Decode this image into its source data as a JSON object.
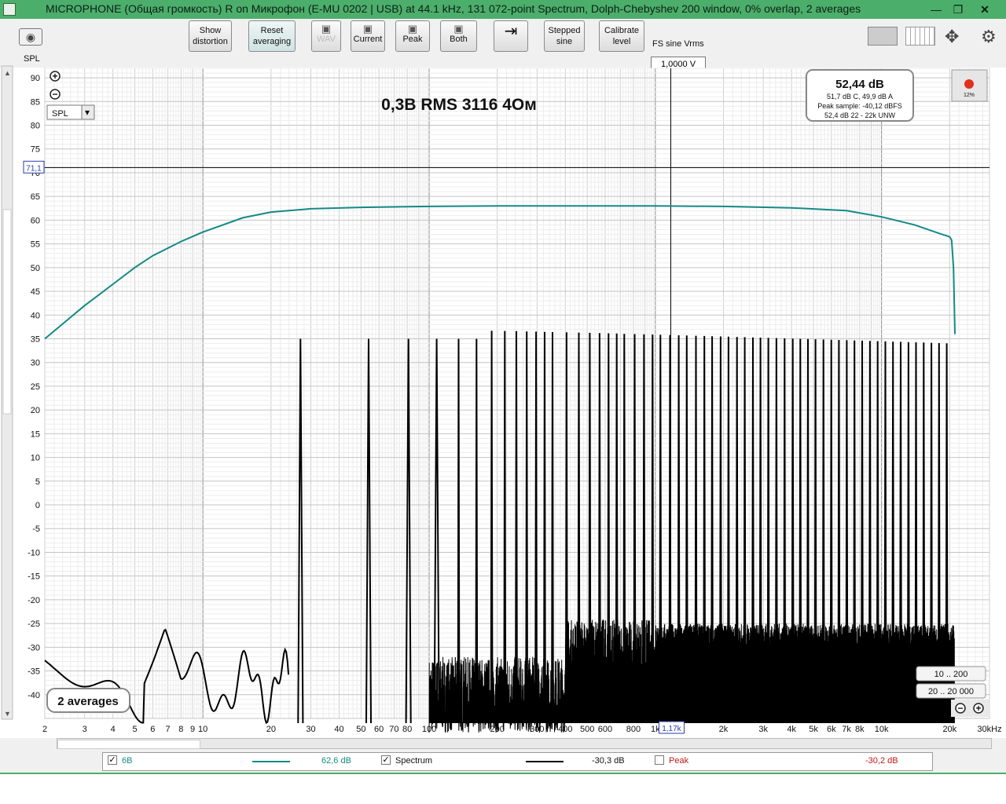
{
  "window": {
    "title": "MICROPHONE (Общая громкость) R on Микрофон (E-MU 0202 | USB) at 44.1 kHz, 131 072-point Spectrum, Dolph-Chebyshev 200 window, 0% overlap, 2 averages"
  },
  "toolbar": {
    "show_distortion": [
      "Show",
      "distortion"
    ],
    "reset_averaging": [
      "Reset",
      "averaging"
    ],
    "wav": "WAV",
    "current": "Current",
    "peak": "Peak",
    "both": "Both",
    "stepped_sine": [
      "Stepped",
      "sine"
    ],
    "calibrate_level": [
      "Calibrate",
      "level"
    ],
    "fs_label": "FS sine Vrms",
    "fs_value": "1,0000 V"
  },
  "chart": {
    "title": "0,3В RMS 3116 4Ом",
    "y_unit": "SPL",
    "dropdown_value": "SPL",
    "cursor_y": "71,1",
    "cursor_x": "1,17k",
    "averages": "2 averages",
    "readout": {
      "main": "52,44 dB",
      "line1": "51,7 dB C, 49,9 dB A",
      "line2": "Peak sample: -40,12 dBFS",
      "line3": "52,4 dB 22 - 22k UNW"
    },
    "record_pct": "12%",
    "range_buttons": [
      "10 .. 200",
      "20 .. 20 000"
    ],
    "colors": {
      "teal": "#138a86",
      "spectrum": "#000000",
      "peak": "#c01818",
      "grid": "#c8c8c8"
    }
  },
  "chart_data": {
    "type": "line",
    "title": "0,3В RMS 3116 4Ом",
    "ylabel": "SPL",
    "xlabel": "",
    "xscale": "log",
    "xlim": [
      2,
      30000
    ],
    "ylim": [
      -45,
      92
    ],
    "yticks": [
      90,
      85,
      80,
      75,
      70,
      65,
      60,
      55,
      50,
      45,
      40,
      35,
      30,
      25,
      20,
      15,
      10,
      5,
      0,
      -5,
      -10,
      -15,
      -20,
      -25,
      -30,
      -35,
      -40
    ],
    "xtick_labels": [
      {
        "v": 2,
        "t": "2"
      },
      {
        "v": 3,
        "t": "3"
      },
      {
        "v": 4,
        "t": "4"
      },
      {
        "v": 5,
        "t": "5"
      },
      {
        "v": 6,
        "t": "6"
      },
      {
        "v": 7,
        "t": "7"
      },
      {
        "v": 8,
        "t": "8"
      },
      {
        "v": 9,
        "t": "9"
      },
      {
        "v": 10,
        "t": "10"
      },
      {
        "v": 20,
        "t": "20"
      },
      {
        "v": 30,
        "t": "30"
      },
      {
        "v": 40,
        "t": "40"
      },
      {
        "v": 50,
        "t": "50"
      },
      {
        "v": 60,
        "t": "60"
      },
      {
        "v": 70,
        "t": "70"
      },
      {
        "v": 80,
        "t": "80"
      },
      {
        "v": 100,
        "t": "100"
      },
      {
        "v": 200,
        "t": "200"
      },
      {
        "v": 300,
        "t": "300"
      },
      {
        "v": 400,
        "t": "400"
      },
      {
        "v": 500,
        "t": "500"
      },
      {
        "v": 600,
        "t": "600"
      },
      {
        "v": 800,
        "t": "800"
      },
      {
        "v": 1000,
        "t": "1k"
      },
      {
        "v": 2000,
        "t": "2k"
      },
      {
        "v": 3000,
        "t": "3k"
      },
      {
        "v": 4000,
        "t": "4k"
      },
      {
        "v": 5000,
        "t": "5k"
      },
      {
        "v": 6000,
        "t": "6k"
      },
      {
        "v": 7000,
        "t": "7k"
      },
      {
        "v": 8000,
        "t": "8k"
      },
      {
        "v": 10000,
        "t": "10k"
      },
      {
        "v": 20000,
        "t": "20k"
      },
      {
        "v": 30000,
        "t": "30kHz"
      }
    ],
    "series": [
      {
        "name": "6B",
        "color": "#138a86",
        "points": [
          [
            2,
            35
          ],
          [
            3,
            42
          ],
          [
            4,
            46.5
          ],
          [
            5,
            50
          ],
          [
            6,
            52.5
          ],
          [
            8,
            55.5
          ],
          [
            10,
            57.5
          ],
          [
            15,
            60.5
          ],
          [
            20,
            61.7
          ],
          [
            30,
            62.4
          ],
          [
            50,
            62.7
          ],
          [
            100,
            62.9
          ],
          [
            200,
            63
          ],
          [
            500,
            63
          ],
          [
            1000,
            63
          ],
          [
            2000,
            62.9
          ],
          [
            4000,
            62.6
          ],
          [
            7000,
            62
          ],
          [
            10000,
            60.7
          ],
          [
            14000,
            59
          ],
          [
            18000,
            57.2
          ],
          [
            20000,
            56.5
          ],
          [
            20400,
            55.8
          ],
          [
            20800,
            50
          ],
          [
            21100,
            36
          ]
        ]
      },
      {
        "name": "Spectrum",
        "color": "#000000",
        "fundamental_hz": 27,
        "fundamental_dB": 35,
        "harmonics_to_hz": 20500,
        "harmonic_dB_range": [
          32,
          37
        ],
        "noise_floor_dB_range": [
          -38,
          -26
        ]
      }
    ]
  },
  "legend": [
    {
      "checked": true,
      "name": "6B",
      "value": "62,6 dB",
      "color": "#138a86"
    },
    {
      "checked": true,
      "name": "Spectrum",
      "value": "-30,3 dB",
      "color": "#000000"
    },
    {
      "checked": false,
      "name": "Peak",
      "value": "-30,2 dB",
      "color": "#c01818"
    }
  ]
}
